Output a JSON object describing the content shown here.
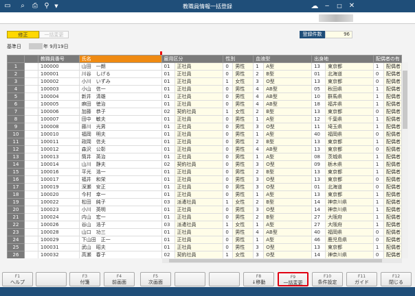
{
  "window": {
    "title": "教職員情報一括登録",
    "icons": [
      "window-icon",
      "search-doc-icon",
      "print-icon",
      "tool-icon",
      "dropdown-icon"
    ],
    "controls": [
      "minimize",
      "maximize",
      "close"
    ]
  },
  "toolbar": {
    "modify_label": "修正",
    "bulk_change_label": "一括変更",
    "count_label": "登録件数",
    "count_value": "96"
  },
  "base_date": {
    "label": "基準日",
    "year_suffix": "年",
    "date": "9月19日"
  },
  "table": {
    "headers": [
      "教職員番号",
      "氏名",
      "雇用区分",
      "性別",
      "血液型",
      "出身地",
      "配偶者の有"
    ],
    "rows": [
      [
        "1",
        "100000",
        "山田　一朗",
        "01",
        "正社員",
        "0",
        "男性",
        "1",
        "A型",
        "13",
        "東京都",
        "1",
        "配偶者"
      ],
      [
        "2",
        "100001",
        "川谷　しげる",
        "01",
        "正社員",
        "0",
        "男性",
        "2",
        "B型",
        "01",
        "北海道",
        "0",
        "配偶者"
      ],
      [
        "3",
        "100002",
        "小川　いずみ",
        "01",
        "正社員",
        "1",
        "女性",
        "3",
        "O型",
        "13",
        "東京都",
        "0",
        "配偶者"
      ],
      [
        "4",
        "100003",
        "小山　信一",
        "01",
        "正社員",
        "0",
        "男性",
        "4",
        "AB型",
        "05",
        "秋田県",
        "1",
        "配偶者"
      ],
      [
        "5",
        "100004",
        "新井　清雄",
        "01",
        "正社員",
        "0",
        "男性",
        "4",
        "AB型",
        "10",
        "群馬県",
        "1",
        "配偶者"
      ],
      [
        "6",
        "100005",
        "麻田　徳治",
        "01",
        "正社員",
        "0",
        "男性",
        "4",
        "AB型",
        "18",
        "福井県",
        "1",
        "配偶者"
      ],
      [
        "7",
        "100006",
        "加藤　恭子",
        "02",
        "契約社員",
        "1",
        "女性",
        "2",
        "B型",
        "13",
        "東京都",
        "0",
        "配偶者"
      ],
      [
        "8",
        "100007",
        "田中　敏夫",
        "01",
        "正社員",
        "0",
        "男性",
        "1",
        "A型",
        "12",
        "千葉県",
        "1",
        "配偶者"
      ],
      [
        "9",
        "100008",
        "藤川　光男",
        "01",
        "正社員",
        "0",
        "男性",
        "3",
        "O型",
        "11",
        "埼玉県",
        "1",
        "配偶者"
      ],
      [
        "10",
        "100010",
        "福岡　明夫",
        "01",
        "正社員",
        "0",
        "男性",
        "1",
        "A型",
        "40",
        "福岡県",
        "0",
        "配偶者"
      ],
      [
        "11",
        "100011",
        "政岡　信夫",
        "01",
        "正社員",
        "0",
        "男性",
        "2",
        "B型",
        "13",
        "東京都",
        "1",
        "配偶者"
      ],
      [
        "12",
        "100012",
        "森沢　公彰",
        "01",
        "正社員",
        "0",
        "男性",
        "4",
        "AB型",
        "13",
        "東京都",
        "0",
        "配偶者"
      ],
      [
        "13",
        "100013",
        "筒井　英治",
        "01",
        "正社員",
        "0",
        "男性",
        "1",
        "A型",
        "08",
        "茨城県",
        "1",
        "配偶者"
      ],
      [
        "14",
        "100014",
        "山川　静夫",
        "02",
        "契約社員",
        "0",
        "男性",
        "3",
        "O型",
        "09",
        "栃木県",
        "1",
        "配偶者"
      ],
      [
        "15",
        "100016",
        "平光　浩一",
        "01",
        "正社員",
        "0",
        "男性",
        "2",
        "B型",
        "13",
        "東京都",
        "1",
        "配偶者"
      ],
      [
        "16",
        "100017",
        "福井　和栄",
        "01",
        "正社員",
        "0",
        "男性",
        "3",
        "O型",
        "13",
        "東京都",
        "0",
        "配偶者"
      ],
      [
        "17",
        "100019",
        "深瀬　安正",
        "01",
        "正社員",
        "0",
        "男性",
        "3",
        "O型",
        "01",
        "北海道",
        "0",
        "配偶者"
      ],
      [
        "18",
        "100020",
        "今村　幸一",
        "01",
        "正社員",
        "0",
        "男性",
        "1",
        "A型",
        "13",
        "東京都",
        "1",
        "配偶者"
      ],
      [
        "19",
        "100022",
        "松田　純子",
        "03",
        "派遣社員",
        "1",
        "女性",
        "2",
        "B型",
        "14",
        "神奈川県",
        "1",
        "配偶者"
      ],
      [
        "20",
        "100023",
        "小川　英明",
        "01",
        "正社員",
        "0",
        "男性",
        "3",
        "O型",
        "14",
        "神奈川県",
        "1",
        "配偶者"
      ],
      [
        "21",
        "100024",
        "内山　宏一",
        "01",
        "正社員",
        "0",
        "男性",
        "2",
        "B型",
        "27",
        "大阪府",
        "1",
        "配偶者"
      ],
      [
        "22",
        "100026",
        "谷山　浩子",
        "03",
        "派遣社員",
        "1",
        "女性",
        "1",
        "A型",
        "27",
        "大阪府",
        "1",
        "配偶者"
      ],
      [
        "23",
        "100028",
        "山口　功三",
        "01",
        "正社員",
        "0",
        "男性",
        "4",
        "AB型",
        "40",
        "福岡県",
        "0",
        "配偶者"
      ],
      [
        "24",
        "100029",
        "下山田　正一",
        "01",
        "正社員",
        "0",
        "男性",
        "1",
        "A型",
        "46",
        "鹿児島県",
        "0",
        "配偶者"
      ],
      [
        "25",
        "100031",
        "武山　昭夫",
        "01",
        "正社員",
        "0",
        "男性",
        "3",
        "O型",
        "13",
        "東京都",
        "1",
        "配偶者"
      ],
      [
        "26",
        "100032",
        "高瀬　春子",
        "02",
        "契約社員",
        "1",
        "女性",
        "3",
        "O型",
        "14",
        "神奈川県",
        "0",
        "配偶者"
      ]
    ]
  },
  "function_keys": [
    {
      "key": "F1",
      "label": "ヘルプ"
    },
    {
      "key": "",
      "label": ""
    },
    {
      "key": "F3",
      "label": "付箋"
    },
    {
      "key": "F4",
      "label": "前画面"
    },
    {
      "key": "F5",
      "label": "次画面"
    },
    {
      "key": "",
      "label": ""
    },
    {
      "key": "",
      "label": ""
    },
    {
      "key": "F8",
      "label": "↓移動"
    },
    {
      "key": "F9",
      "label": "一括変更"
    },
    {
      "key": "F10",
      "label": "条件設定"
    },
    {
      "key": "F11",
      "label": "ガイド"
    },
    {
      "key": "F12",
      "label": "閉じる"
    }
  ]
}
